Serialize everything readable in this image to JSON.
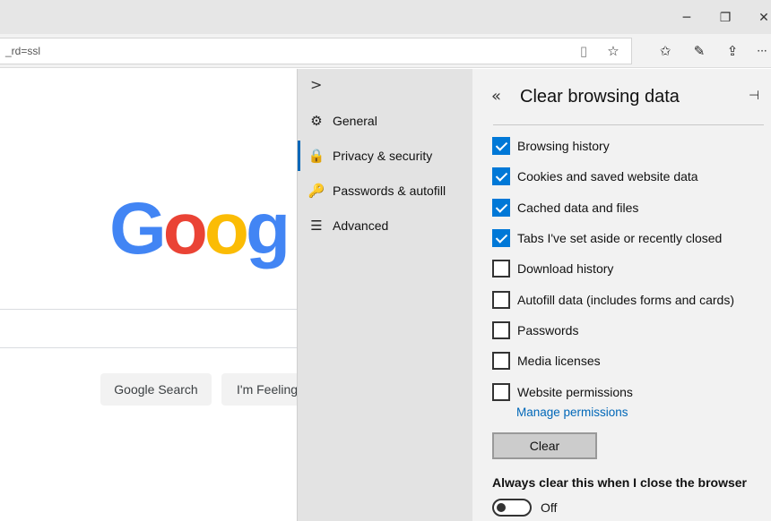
{
  "window": {
    "minimize_icon": "─",
    "restore_icon": "❐",
    "close_icon": "✕"
  },
  "toolbar": {
    "address_text": "_rd=ssl",
    "reading_view_icon": "▯",
    "favorite_icon": "☆",
    "favorites_list_icon": "✩",
    "notes_icon": "✎",
    "share_icon": "⇪",
    "more_icon": "···"
  },
  "google": {
    "logo_letters": [
      {
        "ch": "G",
        "color": "#4285f4"
      },
      {
        "ch": "o",
        "color": "#ea4335"
      },
      {
        "ch": "o",
        "color": "#fbbc05"
      },
      {
        "ch": "g",
        "color": "#4285f4"
      }
    ],
    "search_button": "Google Search",
    "lucky_button": "I'm Feeling"
  },
  "nav": {
    "collapse_icon": ">",
    "items": [
      {
        "label": "General",
        "icon": "⚙"
      },
      {
        "label": "Privacy & security",
        "icon": "🔒"
      },
      {
        "label": "Passwords & autofill",
        "icon": "🔑"
      },
      {
        "label": "Advanced",
        "icon": "☰"
      }
    ],
    "active_index": 1
  },
  "clear_data": {
    "back_icon": "«",
    "title": "Clear browsing data",
    "pin_icon": "⊣",
    "options": [
      {
        "label": "Browsing history",
        "checked": true
      },
      {
        "label": "Cookies and saved website data",
        "checked": true
      },
      {
        "label": "Cached data and files",
        "checked": true
      },
      {
        "label": "Tabs I've set aside or recently closed",
        "checked": true
      },
      {
        "label": "Download history",
        "checked": false
      },
      {
        "label": "Autofill data (includes forms and cards)",
        "checked": false
      },
      {
        "label": "Passwords",
        "checked": false
      },
      {
        "label": "Media licenses",
        "checked": false
      },
      {
        "label": "Website permissions",
        "checked": false
      }
    ],
    "manage_link": "Manage permissions",
    "clear_button": "Clear",
    "always_clear_label": "Always clear this when I close the browser",
    "toggle_state": "Off",
    "accent_color": "#0078d7"
  }
}
